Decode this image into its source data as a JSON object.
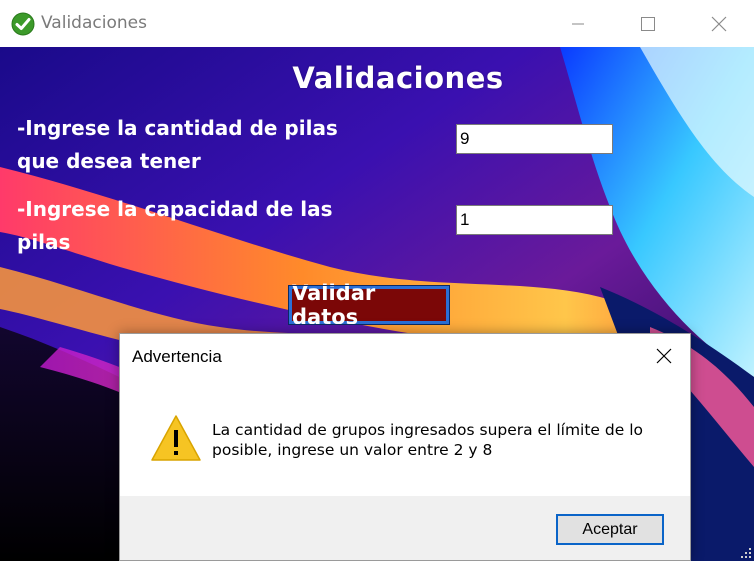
{
  "window": {
    "title": "Validaciones",
    "icon": "check-circle-icon"
  },
  "form": {
    "heading": "Validaciones",
    "stack_count_label": "-Ingrese la cantidad de pilas\nque desea tener",
    "stack_count_value": "9",
    "stack_capacity_label": "-Ingrese la capacidad de las\npilas",
    "stack_capacity_value": "1",
    "validate_button": "Validar datos"
  },
  "dialog": {
    "title": "Advertencia",
    "icon": "warning-icon",
    "message": "La cantidad de grupos ingresados supera el límite de lo\nposible, ingrese un valor entre 2 y 8",
    "ok_button": "Aceptar"
  },
  "colors": {
    "validate_button_bg": "#7b0707",
    "accent_border": "#0a64c8",
    "warning_yellow": "#f6c423"
  }
}
